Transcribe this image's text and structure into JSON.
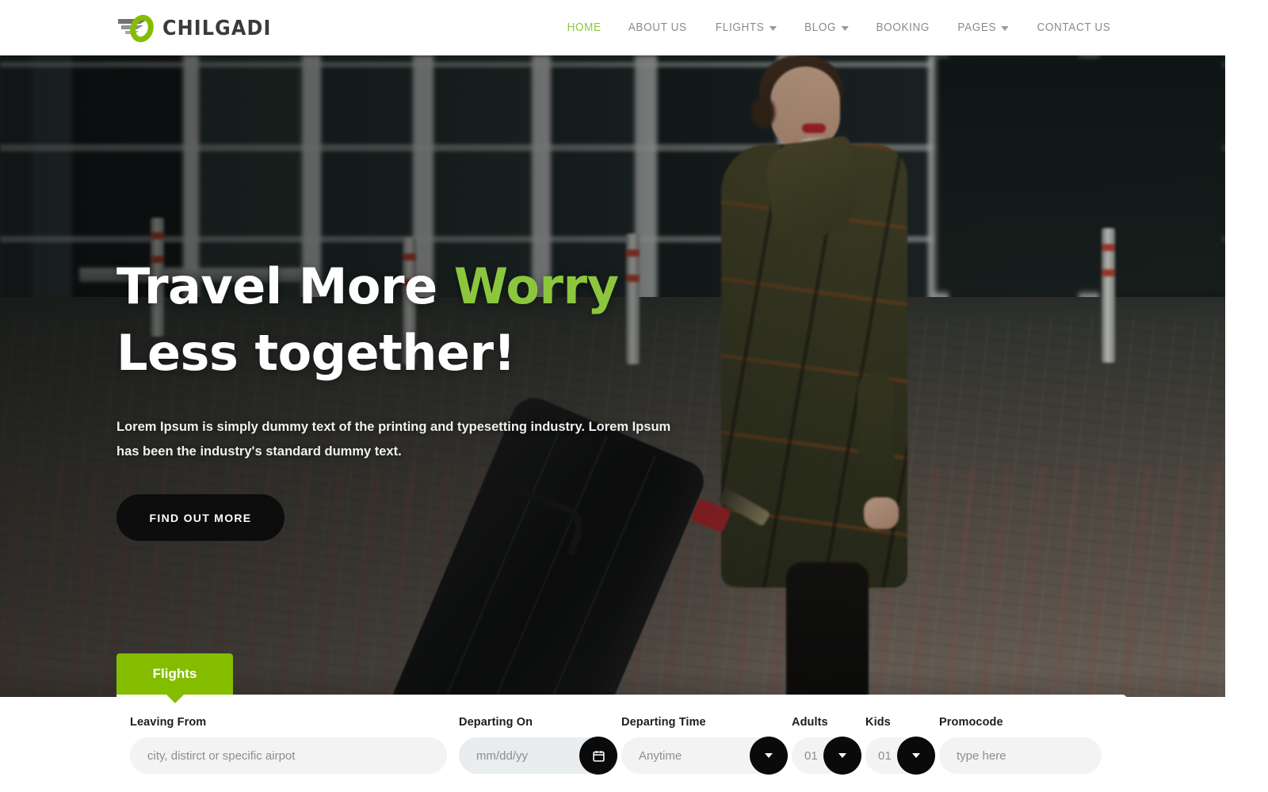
{
  "brand": {
    "name": "CHILGADI",
    "logo_icon": "wing-ring-logo",
    "accent_green": "#84bd00",
    "mark_gray": "#6f7275"
  },
  "nav": {
    "items": [
      {
        "label": "HOME",
        "active": true,
        "has_dropdown": false
      },
      {
        "label": "ABOUT US",
        "active": false,
        "has_dropdown": false
      },
      {
        "label": "FLIGHTS",
        "active": false,
        "has_dropdown": true
      },
      {
        "label": "BLOG",
        "active": false,
        "has_dropdown": true
      },
      {
        "label": "BOOKING",
        "active": false,
        "has_dropdown": false
      },
      {
        "label": "PAGES",
        "active": false,
        "has_dropdown": true
      },
      {
        "label": "CONTACT US",
        "active": false,
        "has_dropdown": false
      }
    ]
  },
  "hero": {
    "title_part1": "Travel More ",
    "title_accent": "Worry",
    "title_part2": " Less together!",
    "subtitle": "Lorem Ipsum is simply dummy text of the printing and typesetting industry. Lorem Ipsum has been the industry's standard dummy text.",
    "cta_label": "FIND OUT MORE",
    "accent_color": "#8cc63e"
  },
  "booking": {
    "tabs": [
      {
        "label": "Flights",
        "active": true
      }
    ],
    "fields": [
      {
        "key": "leaving_from",
        "label": "Leaving From",
        "placeholder": "city, distirct or specific airpot",
        "value": "",
        "control": "text"
      },
      {
        "key": "departing_on",
        "label": "Departing On",
        "placeholder": "mm/dd/yy",
        "value": "",
        "control": "date",
        "button_icon": "calendar-icon"
      },
      {
        "key": "departing_time",
        "label": "Departing Time",
        "placeholder": "Anytime",
        "value": "Anytime",
        "control": "select",
        "button_icon": "chevron-down-icon"
      },
      {
        "key": "adults",
        "label": "Adults",
        "placeholder": "01",
        "value": "01",
        "control": "select",
        "button_icon": "chevron-down-icon"
      },
      {
        "key": "kids",
        "label": "Kids",
        "placeholder": "01",
        "value": "01",
        "control": "select",
        "button_icon": "chevron-down-icon"
      },
      {
        "key": "promocode",
        "label": "Promocode",
        "placeholder": "type here",
        "value": "",
        "control": "text"
      }
    ]
  }
}
